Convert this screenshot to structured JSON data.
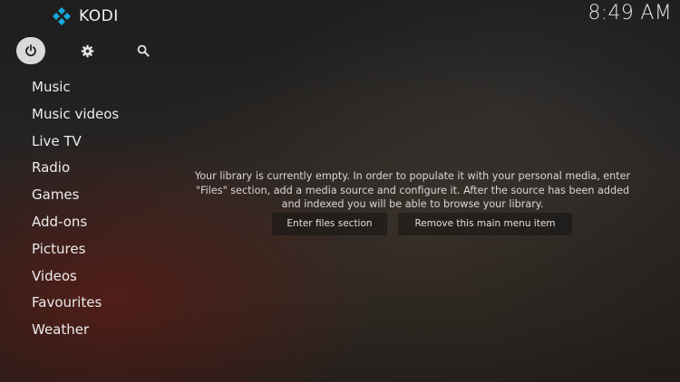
{
  "app": {
    "name": "KODI",
    "clock": "8:49 AM"
  },
  "top_icons": [
    {
      "name": "power-icon",
      "active": true
    },
    {
      "name": "settings-gear-icon",
      "active": false
    },
    {
      "name": "search-icon",
      "active": false
    }
  ],
  "menu": {
    "items": [
      {
        "label": "Music"
      },
      {
        "label": "Music videos"
      },
      {
        "label": "Live TV"
      },
      {
        "label": "Radio"
      },
      {
        "label": "Games"
      },
      {
        "label": "Add-ons"
      },
      {
        "label": "Pictures"
      },
      {
        "label": "Videos"
      },
      {
        "label": "Favourites"
      },
      {
        "label": "Weather"
      }
    ]
  },
  "main": {
    "message_lines": [
      "Your library is currently empty. In order to populate it with your personal media, enter",
      "\"Files\" section, add a media source and configure it. After the source has been added",
      "and indexed you will be able to browse your library."
    ],
    "buttons": {
      "enter_files": "Enter files section",
      "remove_item": "Remove this main menu item"
    }
  },
  "colors": {
    "logo_blue": "#17a9dd",
    "active_icon_bg": "#d9d9d9",
    "text": "#ececec"
  }
}
